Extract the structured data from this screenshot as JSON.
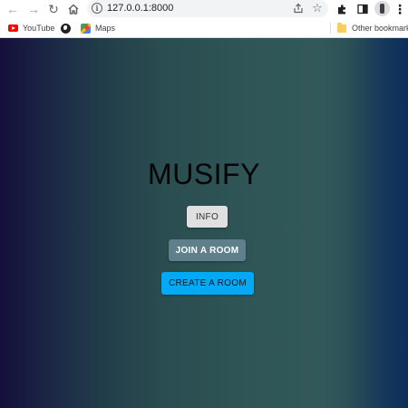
{
  "browser": {
    "url": "127.0.0.1:8000",
    "icons": {
      "back": "arrow-left-icon",
      "forward": "arrow-right-icon",
      "reload": "reload-icon",
      "home": "home-icon",
      "info": "info-icon",
      "share": "share-icon",
      "star": "star-icon",
      "extensions": "puzzle-icon",
      "side_panel": "side-panel-icon",
      "profile": "profile-icon",
      "menu": "kebab-menu-icon"
    }
  },
  "bookmarks": {
    "items": [
      {
        "label": "YouTube",
        "icon": "youtube-icon"
      },
      {
        "label": "",
        "icon": "globe-icon"
      },
      {
        "label": "Maps",
        "icon": "maps-icon"
      }
    ],
    "other": {
      "label": "Other bookmarks",
      "icon": "folder-icon"
    }
  },
  "page": {
    "title": "MUSIFY",
    "buttons": {
      "info": "INFO",
      "join": "JOIN A ROOM",
      "create": "CREATE A ROOM"
    },
    "colors": {
      "gradient_left": "#140f3b",
      "gradient_mid": "#2f5556",
      "gradient_right": "#0c2e5b",
      "info_button": "#e0e0e0",
      "join_button": "#5f7f8a",
      "create_button": "#03a9f4"
    }
  }
}
